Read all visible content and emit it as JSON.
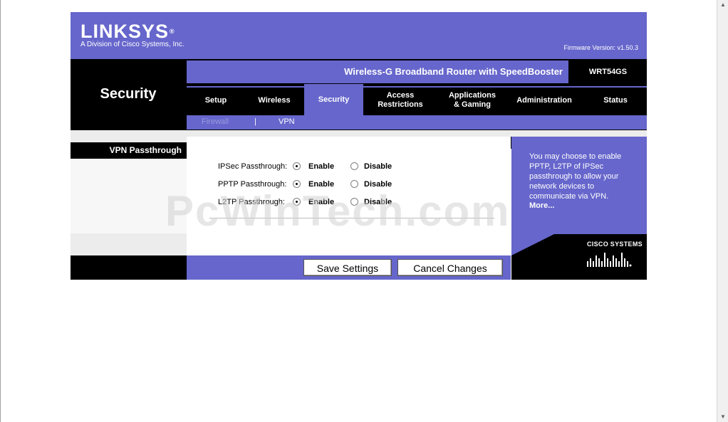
{
  "brand": {
    "logo": "LINKSYS",
    "reg": "®",
    "subtitle": "A Division of Cisco Systems, Inc."
  },
  "firmware": "Firmware Version: v1.50.3",
  "product": {
    "name": "Wireless-G Broadband Router with SpeedBooster",
    "model": "WRT54GS"
  },
  "page_title": "Security",
  "nav": {
    "tabs": [
      {
        "label": "Setup"
      },
      {
        "label": "Wireless"
      },
      {
        "label": "Security"
      },
      {
        "label": "Access\nRestrictions"
      },
      {
        "label": "Applications\n& Gaming"
      },
      {
        "label": "Administration"
      },
      {
        "label": "Status"
      }
    ],
    "active_tab": "Security"
  },
  "subnav": {
    "items": [
      {
        "label": "Firewall"
      },
      {
        "label": "|"
      },
      {
        "label": "VPN"
      }
    ],
    "active": "VPN"
  },
  "section_label": "VPN Passthrough",
  "settings": [
    {
      "label": "IPSec Passthrough:",
      "enable": "Enable",
      "disable": "Disable",
      "selected": "Enable"
    },
    {
      "label": "PPTP Passthrough:",
      "enable": "Enable",
      "disable": "Disable",
      "selected": "Enable"
    },
    {
      "label": "L2TP Passthrough:",
      "enable": "Enable",
      "disable": "Disable",
      "selected": "Enable"
    }
  ],
  "help": {
    "text": "You may choose to enable PPTP, L2TP of IPSec passthrough to allow your network devices to communicate via VPN.",
    "more": "More..."
  },
  "cisco": "CISCO SYSTEMS",
  "buttons": {
    "save": "Save Settings",
    "cancel": "Cancel Changes"
  },
  "watermark": "PcWinTech.com",
  "colors": {
    "brand_purple": "#6666cc",
    "black": "#000000",
    "panel_gray": "#ececec"
  }
}
